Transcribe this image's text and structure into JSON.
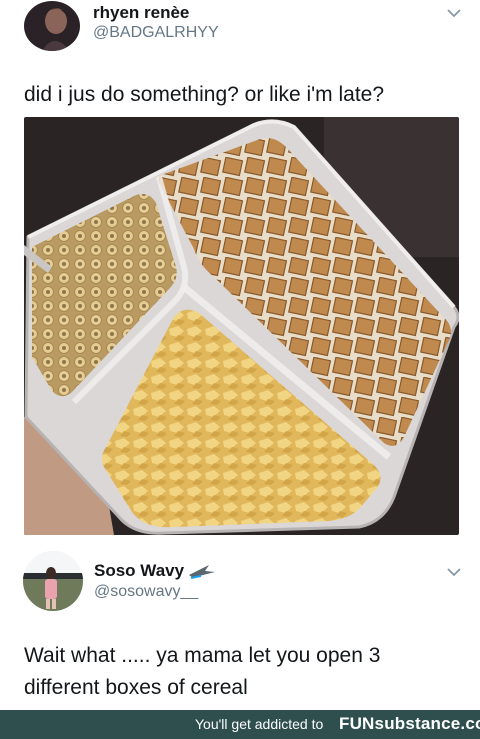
{
  "tweet1": {
    "display_name": "rhyen renèe",
    "handle": "@BADGALRHYY",
    "text": "did i jus do something? or like i'm late?",
    "menu_icon": "chevron-down-icon"
  },
  "tweet2": {
    "display_name": "Soso Wavy",
    "badge_icon": "bird-flying-icon",
    "handle": "@sosowavy__",
    "text_line1": "Wait what ..... ya mama let you open 3",
    "text_line2": "different boxes of cereal",
    "menu_icon": "chevron-down-icon"
  },
  "footer": {
    "caption": "You'll get addicted to",
    "brand": "FUNsubstance.com"
  }
}
